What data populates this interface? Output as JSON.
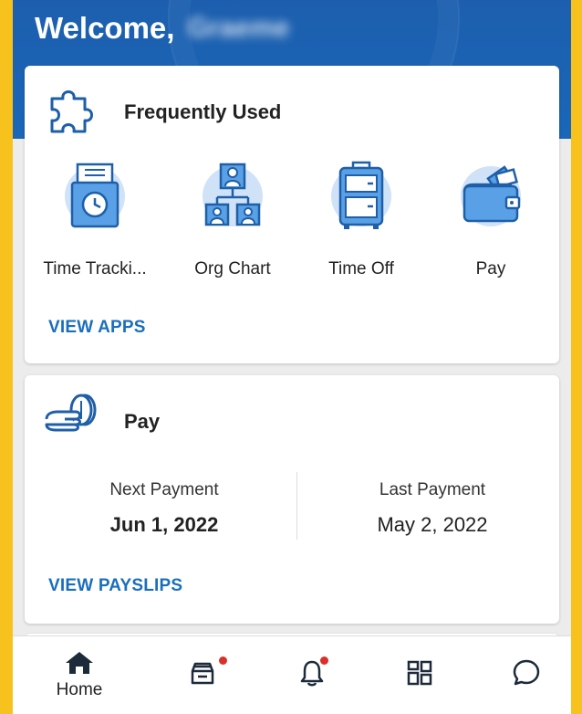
{
  "header": {
    "welcome": "Welcome,",
    "name_blurred": "Graeme"
  },
  "frequently_used": {
    "title": "Frequently Used",
    "apps": [
      {
        "label": "Time Tracki...",
        "icon": "time-tracking-icon"
      },
      {
        "label": "Org Chart",
        "icon": "org-chart-icon"
      },
      {
        "label": "Time Off",
        "icon": "time-off-icon"
      },
      {
        "label": "Pay",
        "icon": "pay-wallet-icon"
      }
    ],
    "view_apps": "VIEW APPS"
  },
  "pay": {
    "title": "Pay",
    "next_payment_label": "Next Payment",
    "next_payment_value": "Jun 1, 2022",
    "last_payment_label": "Last Payment",
    "last_payment_value": "May 2, 2022",
    "view_payslips": "VIEW PAYSLIPS"
  },
  "nav": {
    "items": [
      {
        "label": "Home",
        "icon": "home-icon"
      },
      {
        "label": "",
        "icon": "inbox-icon"
      },
      {
        "label": "",
        "icon": "bell-icon"
      },
      {
        "label": "",
        "icon": "apps-grid-icon"
      },
      {
        "label": "",
        "icon": "chat-icon"
      }
    ]
  },
  "colors": {
    "frame": "#f7c21e",
    "header_blue": "#1a66b8",
    "link_blue": "#1a6fbd",
    "icon_blue": "#1e6dc2",
    "icon_bg": "#cfe2f8",
    "badge_red": "#d9302c"
  }
}
